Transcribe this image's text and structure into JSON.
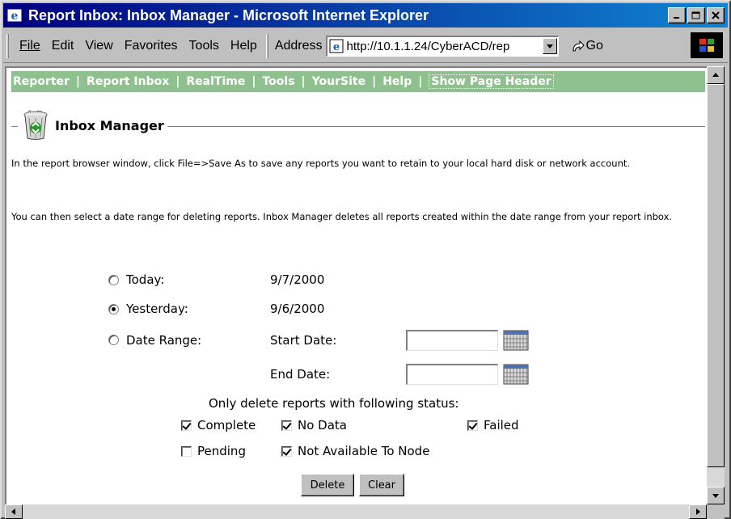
{
  "window": {
    "title": "Report Inbox: Inbox Manager - Microsoft Internet Explorer"
  },
  "menu": [
    "File",
    "Edit",
    "View",
    "Favorites",
    "Tools",
    "Help"
  ],
  "address": {
    "label": "Address",
    "url": "http://10.1.1.24/CyberACD/rep",
    "go_label": "Go"
  },
  "nav": {
    "links": [
      "Reporter",
      "Report Inbox",
      "RealTime",
      "Tools",
      "YourSite",
      "Help"
    ],
    "separator": "|",
    "show_header": "Show Page Header"
  },
  "section": {
    "title": "Inbox Manager"
  },
  "paragraphs": [
    "In the report browser window, click File=>Save As to save any reports you want to retain to your local hard disk or network account.",
    "You can then select a date range for deleting reports. Inbox Manager deletes all reports created within the date range from your report inbox."
  ],
  "options": {
    "today_label": "Today:",
    "today_date": "9/7/2000",
    "yesterday_label": "Yesterday:",
    "yesterday_date": "9/6/2000",
    "range_label": "Date Range:",
    "start_label": "Start Date:",
    "end_label": "End Date:",
    "start_value": "",
    "end_value": "",
    "selected": "yesterday"
  },
  "status": {
    "heading": "Only delete reports with following status:",
    "complete": "Complete",
    "no_data": "No Data",
    "failed": "Failed",
    "pending": "Pending",
    "not_available": "Not Available To Node"
  },
  "buttons": {
    "delete": "Delete",
    "clear": "Clear"
  },
  "colors": {
    "nav_bar": "#8fc18f",
    "title_bar": "#000080"
  }
}
